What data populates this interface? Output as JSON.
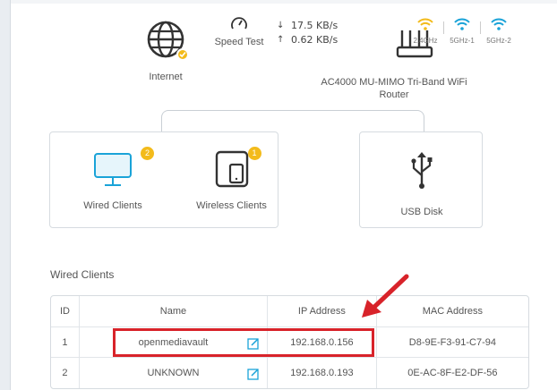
{
  "internet": {
    "label": "Internet",
    "icon": "globe-icon",
    "status": "connected"
  },
  "speed_test": {
    "label": "Speed Test",
    "icon": "speedometer-icon"
  },
  "rates": {
    "download": "17.5 KB/s",
    "upload": "0.62 KB/s"
  },
  "router": {
    "name": "AC4000 MU-MIMO Tri-Band WiFi Router",
    "icon": "router-icon"
  },
  "bands": [
    {
      "label": "2.4GHz",
      "color": "#f3bb1b"
    },
    {
      "label": "5GHz-1",
      "color": "#1aa3d8"
    },
    {
      "label": "5GHz-2",
      "color": "#1aa3d8"
    }
  ],
  "clients": {
    "wired": {
      "label": "Wired Clients",
      "count": "2",
      "icon": "monitor-icon"
    },
    "wireless": {
      "label": "Wireless Clients",
      "count": "1",
      "icon": "tablet-phone-icon"
    }
  },
  "usb": {
    "label": "USB Disk",
    "icon": "usb-icon"
  },
  "wired_clients": {
    "title": "Wired Clients",
    "columns": [
      "ID",
      "Name",
      "IP Address",
      "MAC Address"
    ],
    "rows": [
      {
        "id": "1",
        "name": "openmediavault",
        "ip": "192.168.0.156",
        "mac": "D8-9E-F3-91-C7-94"
      },
      {
        "id": "2",
        "name": "UNKNOWN",
        "ip": "192.168.0.193",
        "mac": "0E-AC-8F-E2-DF-56"
      }
    ]
  },
  "colors": {
    "accent": "#1aa3d8",
    "badge": "#f3bb1b",
    "highlight": "#d8232a"
  }
}
